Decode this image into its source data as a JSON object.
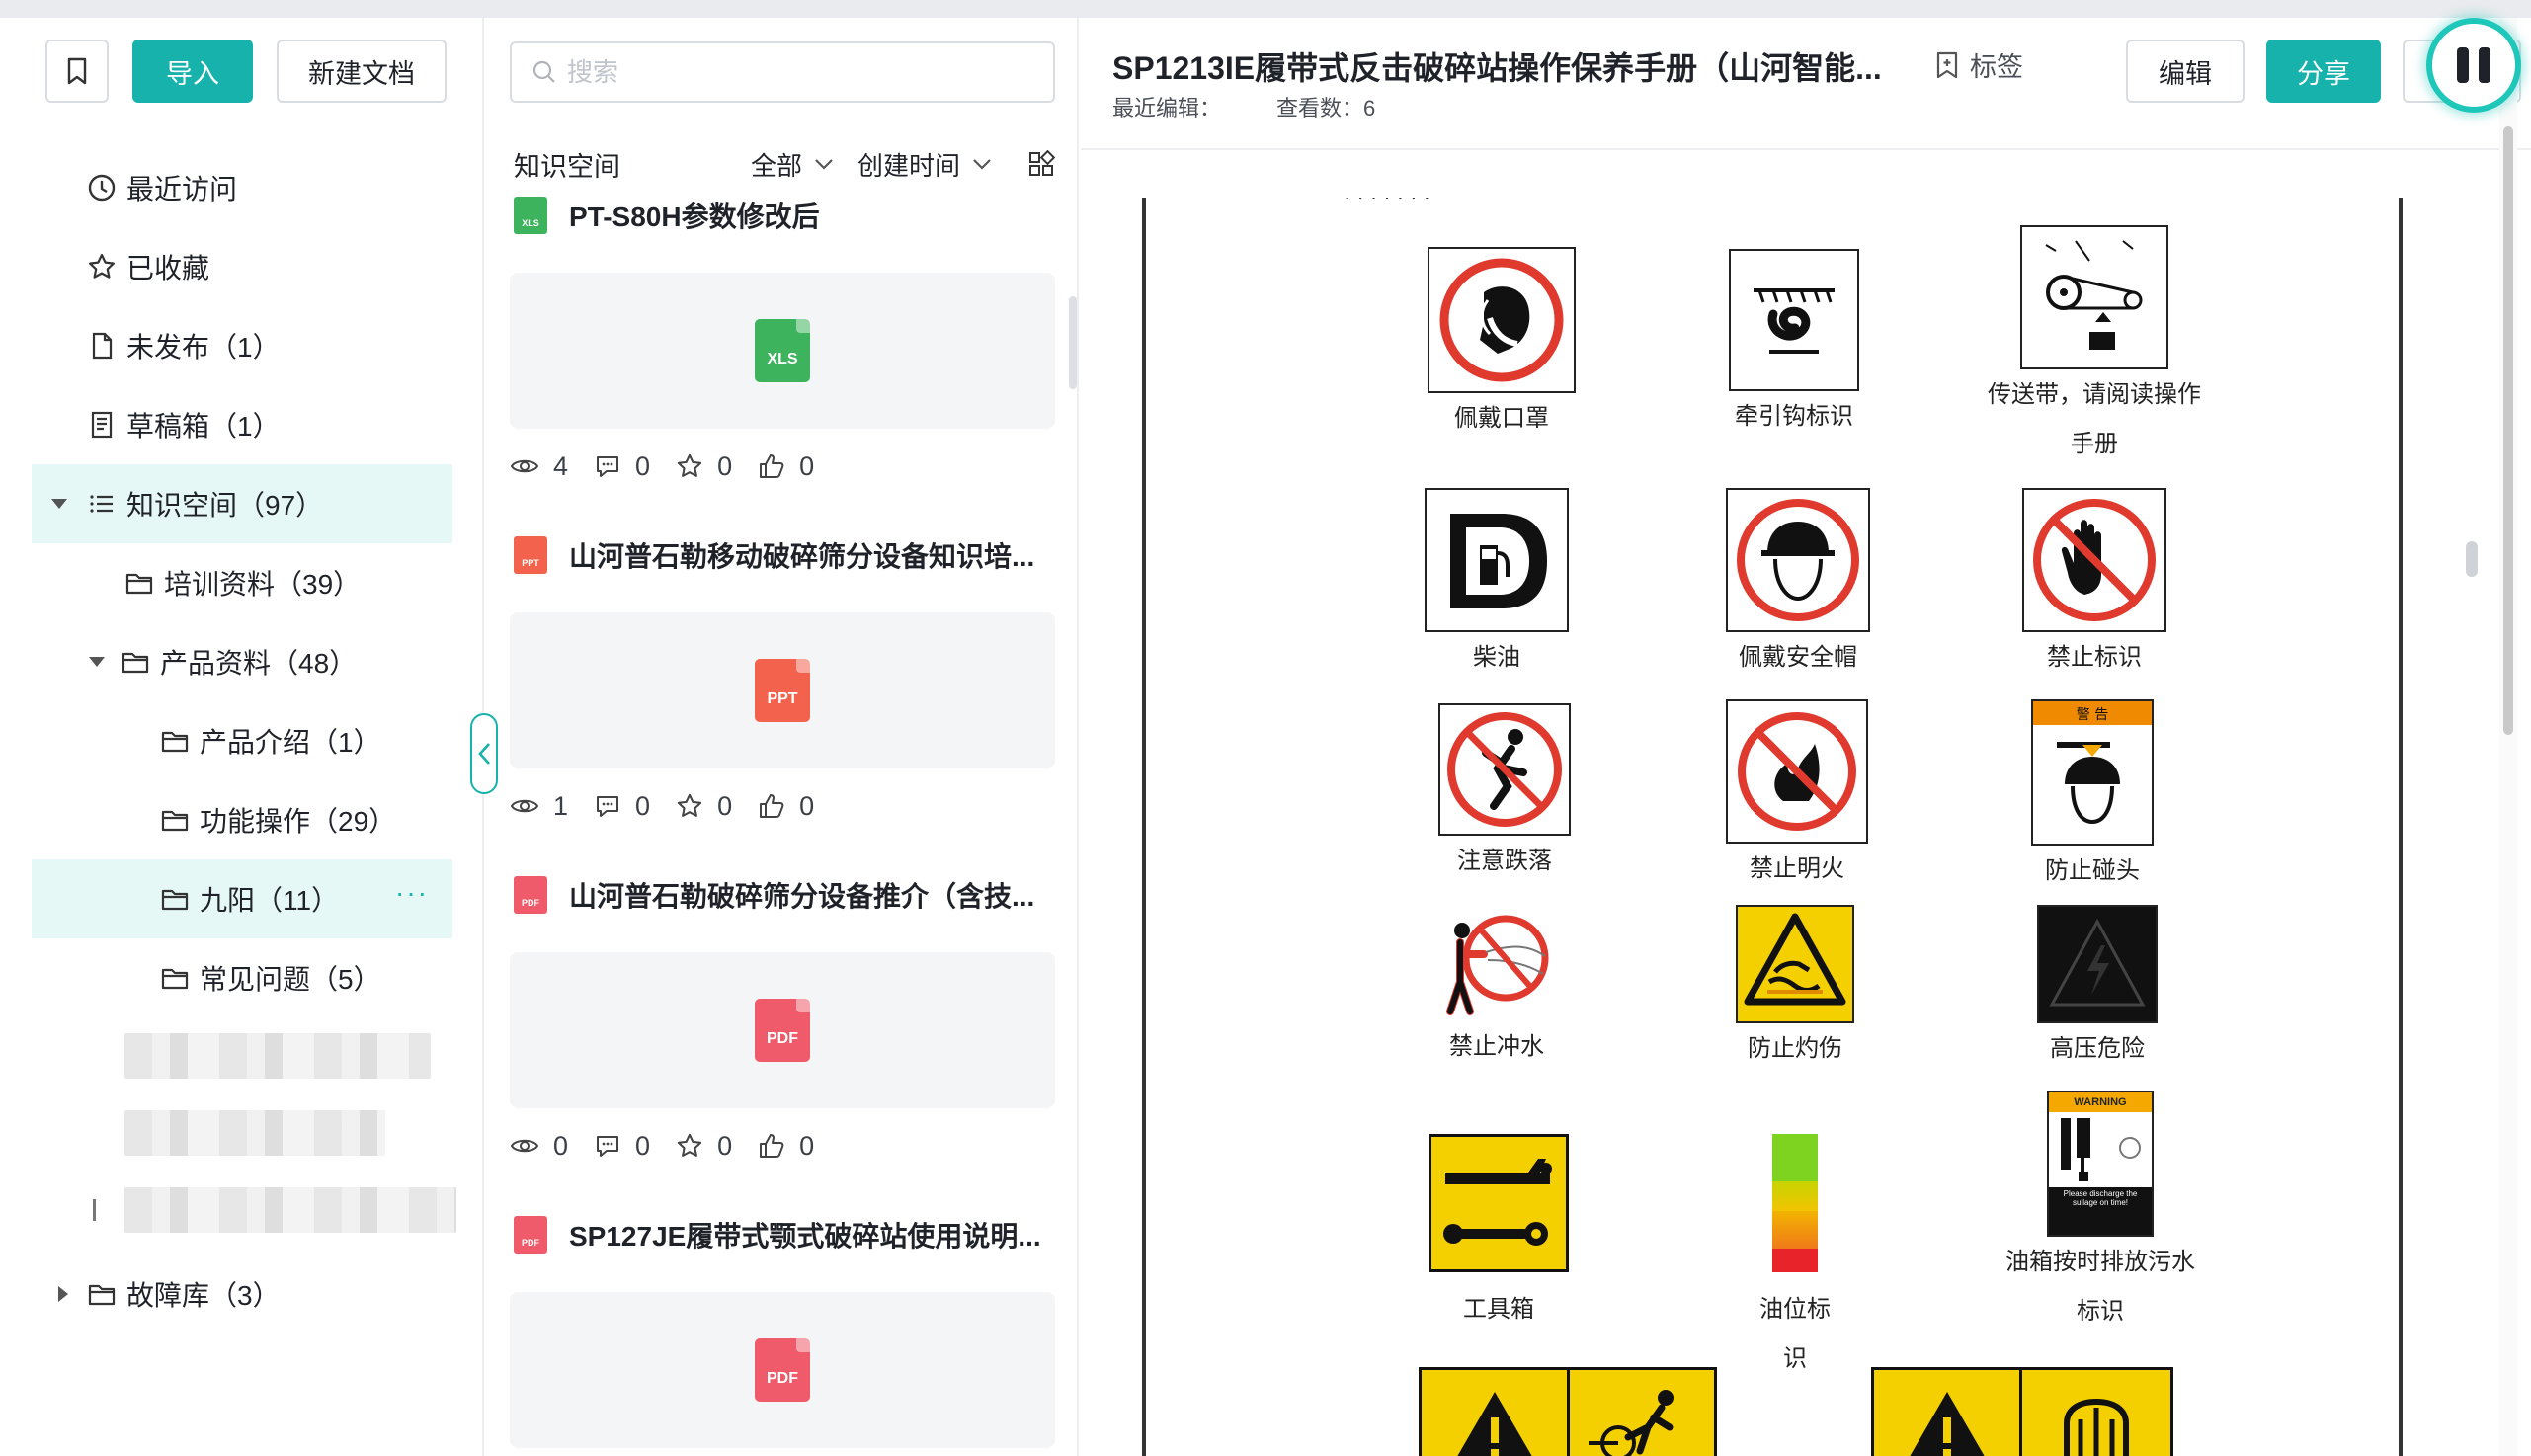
{
  "sidebar": {
    "import_label": "导入",
    "new_doc_label": "新建文档",
    "nav": {
      "recent": "最近访问",
      "favorites": "已收藏",
      "unpublished": "未发布（1）",
      "drafts": "草稿箱（1）",
      "knowledge": "知识空间（97）",
      "training": "培训资料（39）",
      "product": "产品资料（48）",
      "intro": "产品介绍（1）",
      "function": "功能操作（29）",
      "jiuyang": "九阳（11）",
      "faq": "常见问题（5）",
      "fault": "故障库（3）"
    },
    "more": "···"
  },
  "list": {
    "search_placeholder": "搜索",
    "header": "知识空间",
    "filter_all": "全部",
    "filter_time": "创建时间",
    "docs": [
      {
        "title": "PT-S80H参数修改后",
        "type": "XLS",
        "color": "#3eb35e",
        "views": "4",
        "comments": "0",
        "stars": "0",
        "likes": "0"
      },
      {
        "title": "山河普石勒移动破碎筛分设备知识培...",
        "type": "PPT",
        "color": "#f2624c",
        "views": "1",
        "comments": "0",
        "stars": "0",
        "likes": "0"
      },
      {
        "title": "山河普石勒破碎筛分设备推介（含技...",
        "type": "PDF",
        "color": "#ef5b6a",
        "views": "0",
        "comments": "0",
        "stars": "0",
        "likes": "0"
      },
      {
        "title": "SP127JE履带式颚式破碎站使用说明...",
        "type": "PDF",
        "color": "#ef5b6a"
      }
    ]
  },
  "viewer": {
    "title": "SP1213IE履带式反击破碎站操作保养手册（山河智能...",
    "last_edit_label": "最近编辑：",
    "views_label": "查看数：6",
    "tag_label": "标签",
    "edit_label": "编辑",
    "share_label": "分享",
    "signs": {
      "mask": "佩戴口罩",
      "hook": "牵引钩标识",
      "belt_l1": "传送带，请阅读操作",
      "belt_l2": "手册",
      "diesel": "柴油",
      "helmet": "佩戴安全帽",
      "forbid": "禁止标识",
      "fall": "注意跌落",
      "fire": "禁止明火",
      "bump": "防止碰头",
      "water": "禁止冲水",
      "burn": "防止灼伤",
      "voltage": "高压危险",
      "tools": "工具箱",
      "oil": "油位标识",
      "tank_l1": "油箱按时排放污水",
      "tank_l2": "标识"
    },
    "sign_texts": {
      "warning_cn": "警  告",
      "warning_en": "WARNING",
      "discharge": "Please discharge the sullage on time!"
    }
  },
  "colors": {
    "accent": "#16b2ab",
    "red_sign": "#e03a2f",
    "yellow_sign": "#f5d000"
  }
}
